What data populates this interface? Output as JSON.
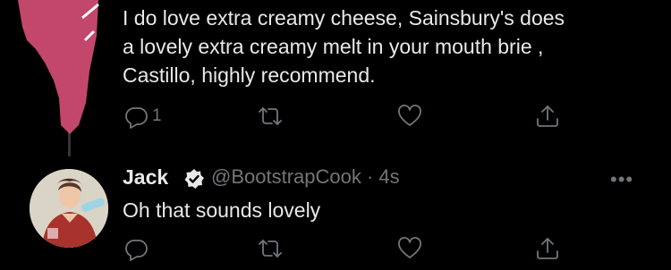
{
  "parent_tweet": {
    "lines": [
      "I do love extra creamy cheese, Sainsbury's does",
      "a lovely extra creamy melt in your mouth brie ,",
      "Castillo, highly recommend."
    ],
    "reply_count": "1"
  },
  "reply_tweet": {
    "name": "Jack",
    "handle_time": "@BootstrapCook · 4s",
    "text": "Oh that sounds lovely",
    "more_label": "•••"
  },
  "colors": {
    "background": "#000000",
    "text": "#e7e9ea",
    "secondary": "#71767b",
    "redaction": "#c2476b"
  },
  "icons": [
    "reply-icon",
    "retweet-icon",
    "like-icon",
    "share-icon",
    "verified-icon"
  ]
}
